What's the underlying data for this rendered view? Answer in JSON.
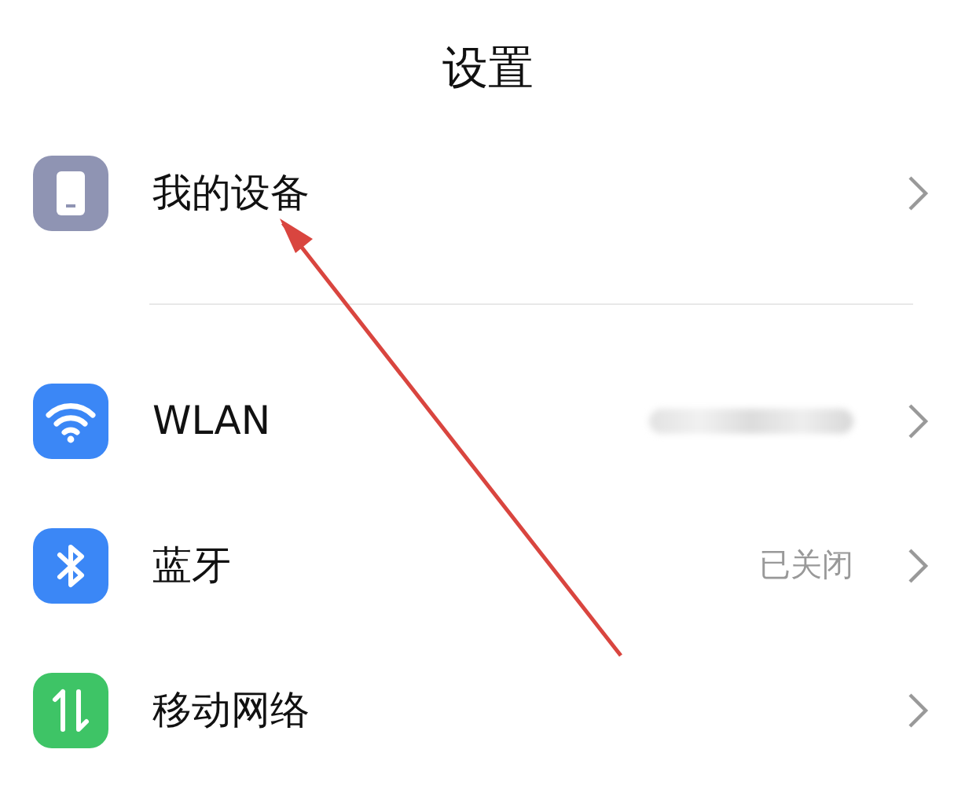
{
  "title": "设置",
  "sections": [
    {
      "items": [
        {
          "kind": "device",
          "label": "我的设备"
        }
      ]
    },
    {
      "items": [
        {
          "kind": "wifi",
          "label": "WLAN",
          "value_hidden": true
        },
        {
          "kind": "bluetooth",
          "label": "蓝牙",
          "value": "已关闭"
        },
        {
          "kind": "mobile",
          "label": "移动网络"
        }
      ]
    }
  ]
}
